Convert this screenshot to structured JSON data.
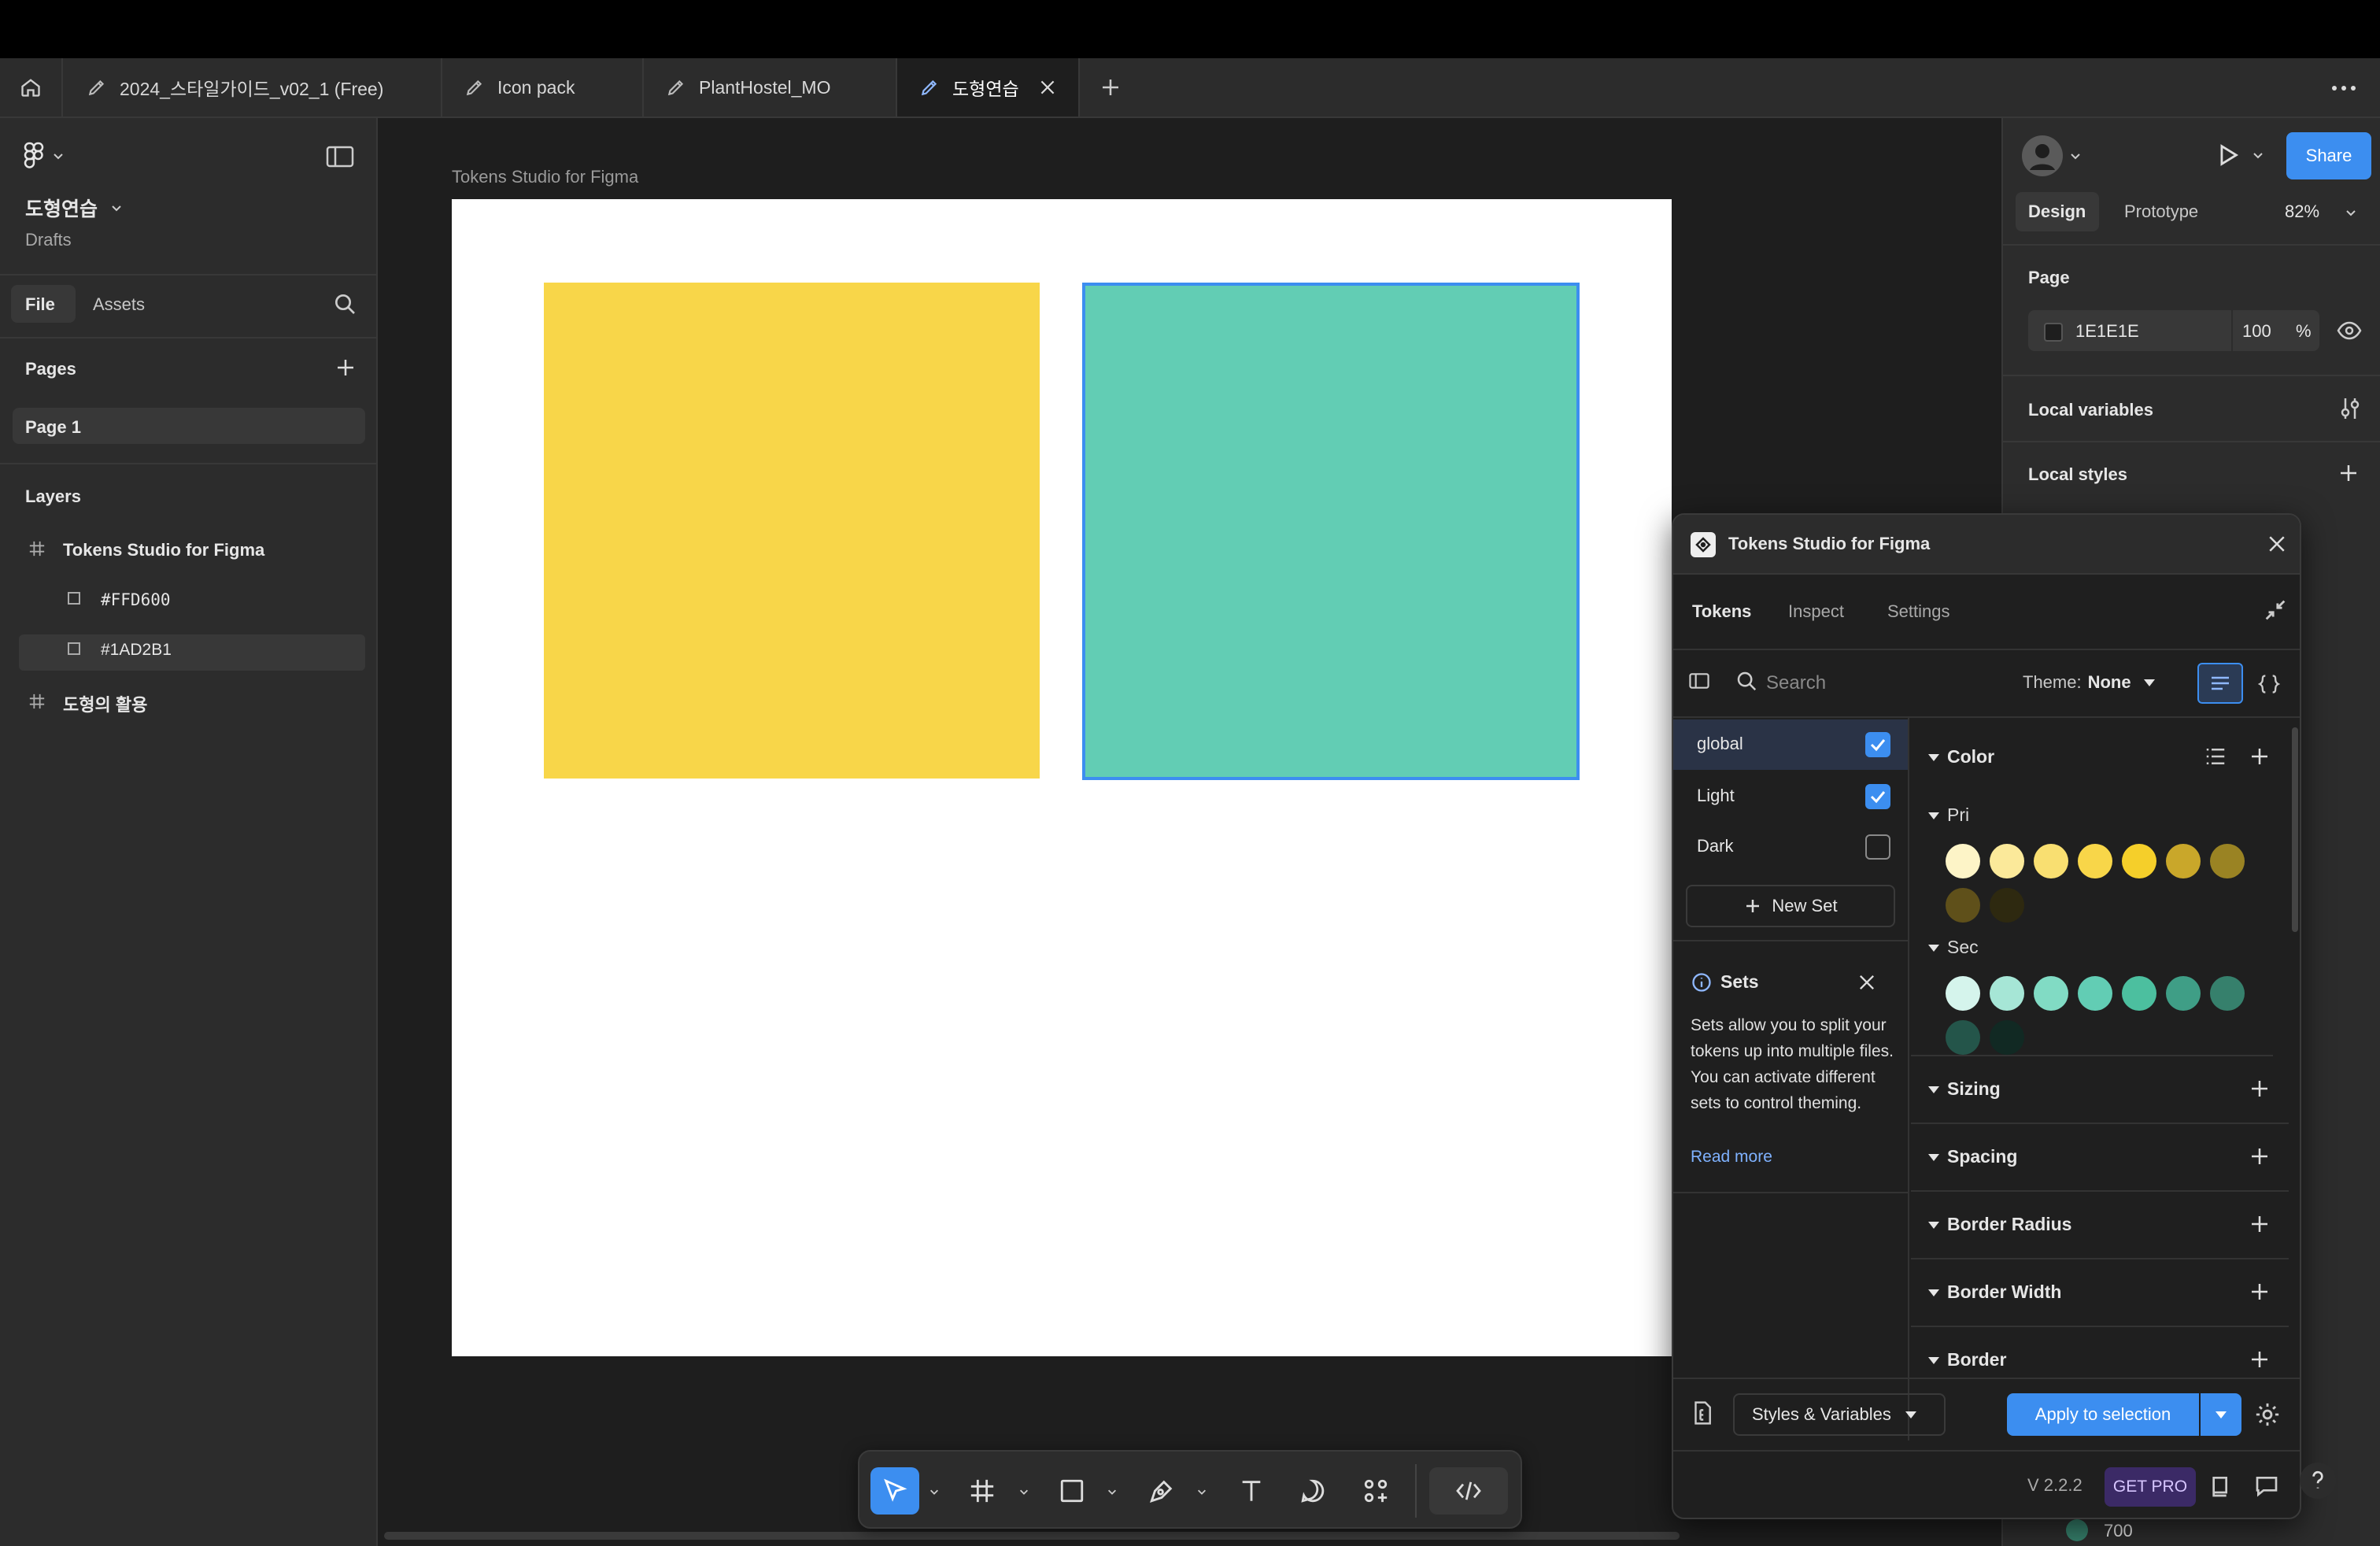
{
  "tabs": [
    {
      "label": "2024_스타일가이드_v02_1 (Free)"
    },
    {
      "label": "Icon pack"
    },
    {
      "label": "PlantHostel_MO"
    },
    {
      "label": "도형연습"
    }
  ],
  "left": {
    "file_name": "도형연습",
    "location": "Drafts",
    "tab_file": "File",
    "tab_assets": "Assets",
    "pages_title": "Pages",
    "page1": "Page 1",
    "layers_title": "Layers",
    "layers": [
      {
        "label": "Tokens Studio for Figma"
      },
      {
        "label": "#FFD600"
      },
      {
        "label": "#1AD2B1"
      },
      {
        "label": "도형의 활용"
      }
    ]
  },
  "canvas": {
    "frame_label": "Tokens Studio for Figma"
  },
  "right": {
    "share": "Share",
    "tab_design": "Design",
    "tab_prototype": "Prototype",
    "zoom": "82%",
    "page_title": "Page",
    "page_color": "1E1E1E",
    "page_opacity": "100",
    "percent": "%",
    "local_variables": "Local variables",
    "local_styles": "Local styles",
    "under_value": "700"
  },
  "plugin": {
    "title": "Tokens Studio for Figma",
    "tab_tokens": "Tokens",
    "tab_inspect": "Inspect",
    "tab_settings": "Settings",
    "search_placeholder": "Search",
    "theme_label": "Theme:",
    "theme_value": "None",
    "sets": [
      {
        "name": "global",
        "checked": true
      },
      {
        "name": "Light",
        "checked": true
      },
      {
        "name": "Dark",
        "checked": false
      }
    ],
    "new_set": "New Set",
    "info_title": "Sets",
    "info_text": "Sets allow you to split your tokens up into multiple files. You can activate different sets to control theming.",
    "read_more": "Read more",
    "color_title": "Color",
    "pri_title": "Pri",
    "pri_colors": [
      "#fdf4c7",
      "#fbe99a",
      "#f9df71",
      "#f8d649",
      "#f5cf2a",
      "#c9a72a",
      "#9a8323",
      "#5f501a",
      "#2e2910"
    ],
    "sec_title": "Sec",
    "sec_colors": [
      "#d5f4ec",
      "#a6e6d6",
      "#81dbc4",
      "#62cdb4",
      "#4cbf9f",
      "#3f9e86",
      "#36806c",
      "#24554a",
      "#112923"
    ],
    "sections": [
      "Sizing",
      "Spacing",
      "Border Radius",
      "Border Width",
      "Border"
    ],
    "styles_vars": "Styles & Variables",
    "apply": "Apply to selection",
    "version": "V 2.2.2",
    "get_pro": "GET PRO"
  }
}
